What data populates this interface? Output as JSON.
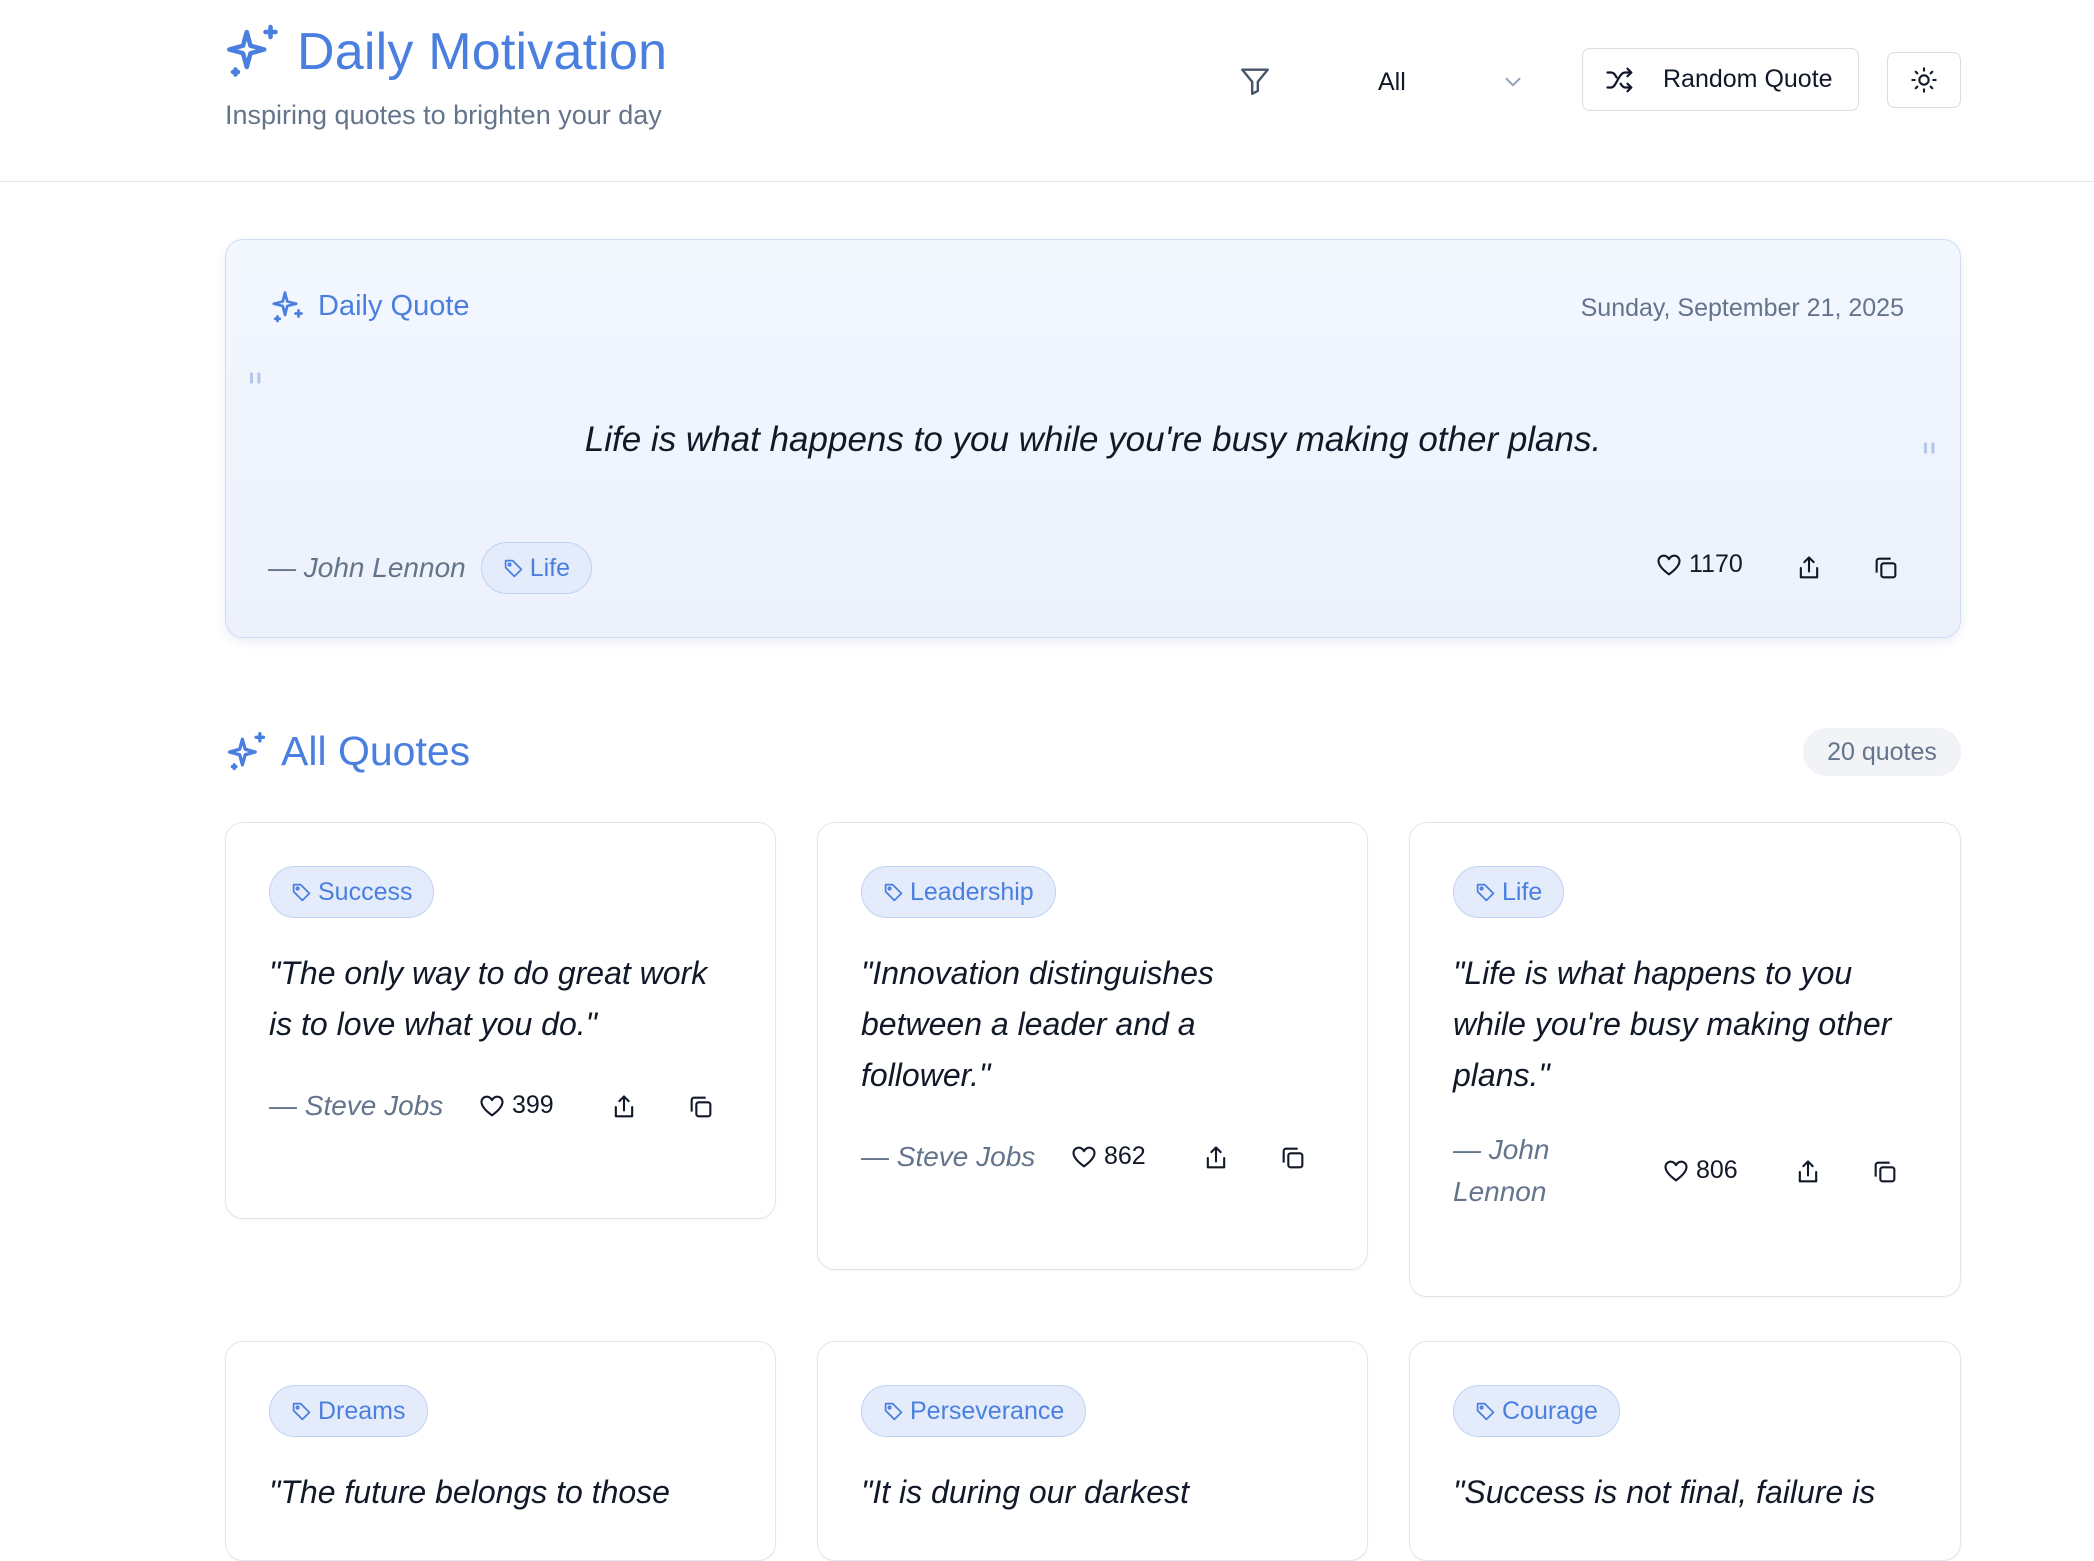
{
  "header": {
    "title": "Daily Motivation",
    "subtitle": "Inspiring quotes to brighten your day",
    "filter_value": "All",
    "random_label": "Random Quote"
  },
  "daily": {
    "label": "Daily Quote",
    "date": "Sunday, September 21, 2025",
    "quote": "Life is what happens to you while you're busy making other plans.",
    "author": "— John Lennon",
    "tag": "Life",
    "likes": "1170"
  },
  "all_quotes": {
    "title": "All Quotes",
    "count": "20 quotes",
    "cards": [
      {
        "tag": "Success",
        "quote": "\"The only way to do great work is to love what you do.\"",
        "author": "— Steve Jobs",
        "likes": "399"
      },
      {
        "tag": "Leadership",
        "quote": "\"Innovation distinguishes between a leader and a follower.\"",
        "author": "— Steve Jobs",
        "likes": "862"
      },
      {
        "tag": "Life",
        "quote": "\"Life is what happens to you while you're busy making other plans.\"",
        "author": "— John Lennon",
        "likes": "806"
      },
      {
        "tag": "Dreams",
        "quote": "\"The future belongs to those"
      },
      {
        "tag": "Perseverance",
        "quote": "\"It is during our darkest"
      },
      {
        "tag": "Courage",
        "quote": "\"Success is not final, failure is"
      }
    ]
  },
  "colors": {
    "accent": "#4a7fe0",
    "muted": "#64748b",
    "card_border": "#e2e6ec"
  }
}
